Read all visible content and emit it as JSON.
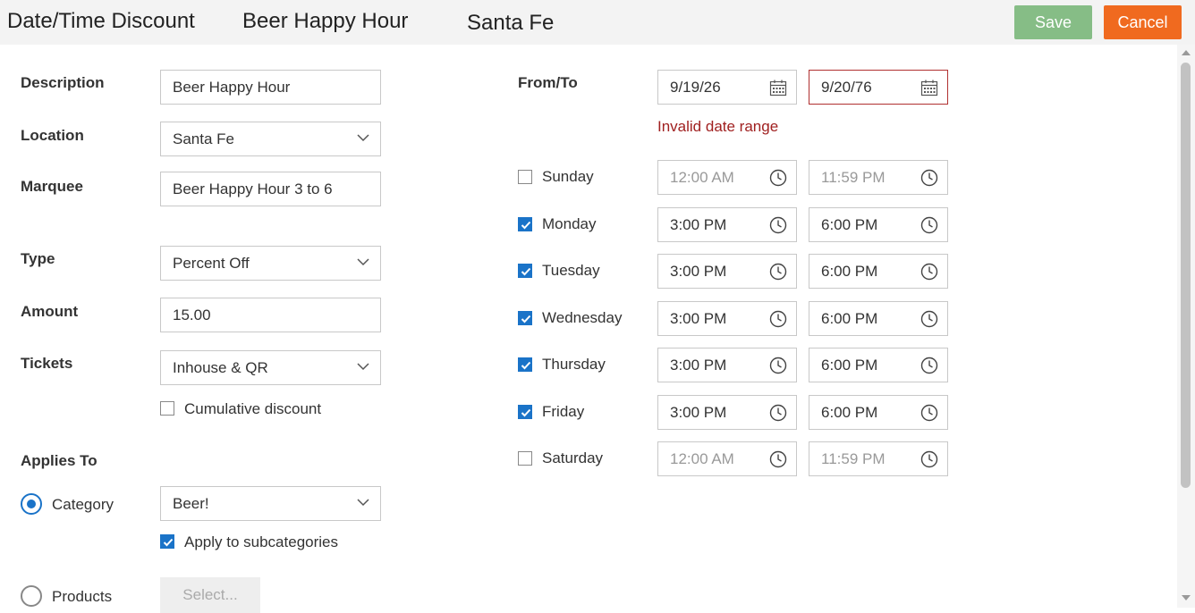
{
  "header": {
    "title": "Date/Time Discount",
    "name": "Beer Happy Hour",
    "location": "Santa Fe",
    "save_label": "Save",
    "cancel_label": "Cancel",
    "save_color": "#86bd86",
    "cancel_color": "#f06a1f"
  },
  "form": {
    "description": {
      "label": "Description",
      "value": "Beer Happy Hour"
    },
    "location": {
      "label": "Location",
      "value": "Santa Fe"
    },
    "marquee": {
      "label": "Marquee",
      "value": "Beer Happy Hour 3 to 6"
    },
    "type": {
      "label": "Type",
      "value": "Percent Off"
    },
    "amount": {
      "label": "Amount",
      "value": "15.00"
    },
    "tickets": {
      "label": "Tickets",
      "value": "Inhouse & QR"
    },
    "cumulative": {
      "label": "Cumulative discount",
      "checked": false
    },
    "applies_to": {
      "label": "Applies To",
      "category_label": "Category",
      "category_selected": true,
      "category_value": "Beer!",
      "subcategories_label": "Apply to subcategories",
      "subcategories_checked": true,
      "products_label": "Products",
      "products_selected": false,
      "select_label": "Select..."
    }
  },
  "schedule": {
    "from_to_label": "From/To",
    "from_date": "9/19/26",
    "to_date": "9/20/76",
    "error": "Invalid date range",
    "error_color": "#a02020",
    "days": [
      {
        "name": "Sunday",
        "checked": false,
        "start": "12:00 AM",
        "end": "11:59 PM"
      },
      {
        "name": "Monday",
        "checked": true,
        "start": "3:00 PM",
        "end": "6:00 PM"
      },
      {
        "name": "Tuesday",
        "checked": true,
        "start": "3:00 PM",
        "end": "6:00 PM"
      },
      {
        "name": "Wednesday",
        "checked": true,
        "start": "3:00 PM",
        "end": "6:00 PM"
      },
      {
        "name": "Thursday",
        "checked": true,
        "start": "3:00 PM",
        "end": "6:00 PM"
      },
      {
        "name": "Friday",
        "checked": true,
        "start": "3:00 PM",
        "end": "6:00 PM"
      },
      {
        "name": "Saturday",
        "checked": false,
        "start": "12:00 AM",
        "end": "11:59 PM"
      }
    ]
  },
  "icons": {
    "dropdown": "chevron-down-icon",
    "date": "calendar-icon",
    "time": "clock-icon",
    "check": "checkmark-icon"
  },
  "accent_color": "#1a73c8"
}
